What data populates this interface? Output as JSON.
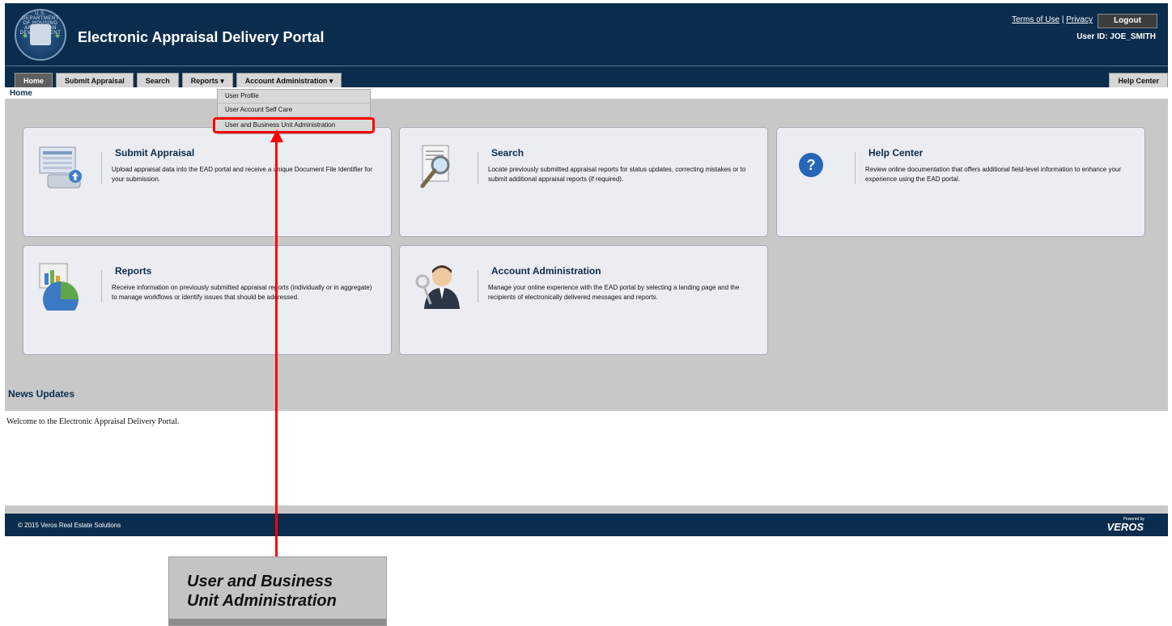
{
  "header": {
    "seal_text": "U.S. DEPARTMENT OF HOUSING AND URBAN DEVELOPMENT",
    "app_title": "Electronic Appraisal Delivery Portal",
    "terms_link": "Terms of Use",
    "divider": "|",
    "privacy_link": "Privacy",
    "logout_label": "Logout",
    "user_id": "User ID: JOE_SMITH"
  },
  "nav": {
    "tabs": [
      {
        "label": "Home"
      },
      {
        "label": "Submit Appraisal"
      },
      {
        "label": "Search"
      },
      {
        "label": "Reports ▾"
      },
      {
        "label": "Account Administration ▾"
      }
    ],
    "help_center": "Help Center"
  },
  "breadcrumb": "Home",
  "dropdown": {
    "items": [
      {
        "label": "User Profile"
      },
      {
        "label": "User Account Self Care"
      },
      {
        "label": "User and Business Unit Administration"
      }
    ]
  },
  "cards": [
    {
      "title": "Submit Appraisal",
      "description": "Upload appraisal data into the EAD portal and receive a unique Document File Identifier for your submission.",
      "icon": "upload-computer-icon"
    },
    {
      "title": "Search",
      "description": "Locate previously submitted appraisal reports for status updates, correcting mistakes or to submit additional appraisal reports (if required).",
      "icon": "magnifier-document-icon"
    },
    {
      "title": "Help Center",
      "description": "Review online documentation that offers additional field-level information to enhance your experience using the EAD portal.",
      "icon": "question-icon"
    },
    {
      "title": "Reports",
      "description": "Receive information on previously submitted appraisal reports (individually or in aggregate) to manage workflows or identify issues that should be addressed.",
      "icon": "report-chart-icon"
    },
    {
      "title": "Account Administration",
      "description": "Manage your online experience with the EAD portal by selecting a landing page and the recipients of electronically delivered messages and reports.",
      "icon": "user-key-icon"
    }
  ],
  "news": {
    "title": "News Updates",
    "text": "Welcome to the Electronic Appraisal Delivery Portal."
  },
  "footer": {
    "copyright": "© 2015 Veros Real Estate Solutions",
    "powered_by": "Powered by",
    "brand": "VEROS"
  },
  "callout": {
    "line1": "User and Business",
    "line2": "Unit Administration"
  },
  "colors": {
    "header_bg": "#0b2d4d",
    "accent_red": "#ff0000",
    "card_bg": "#ececf3"
  }
}
